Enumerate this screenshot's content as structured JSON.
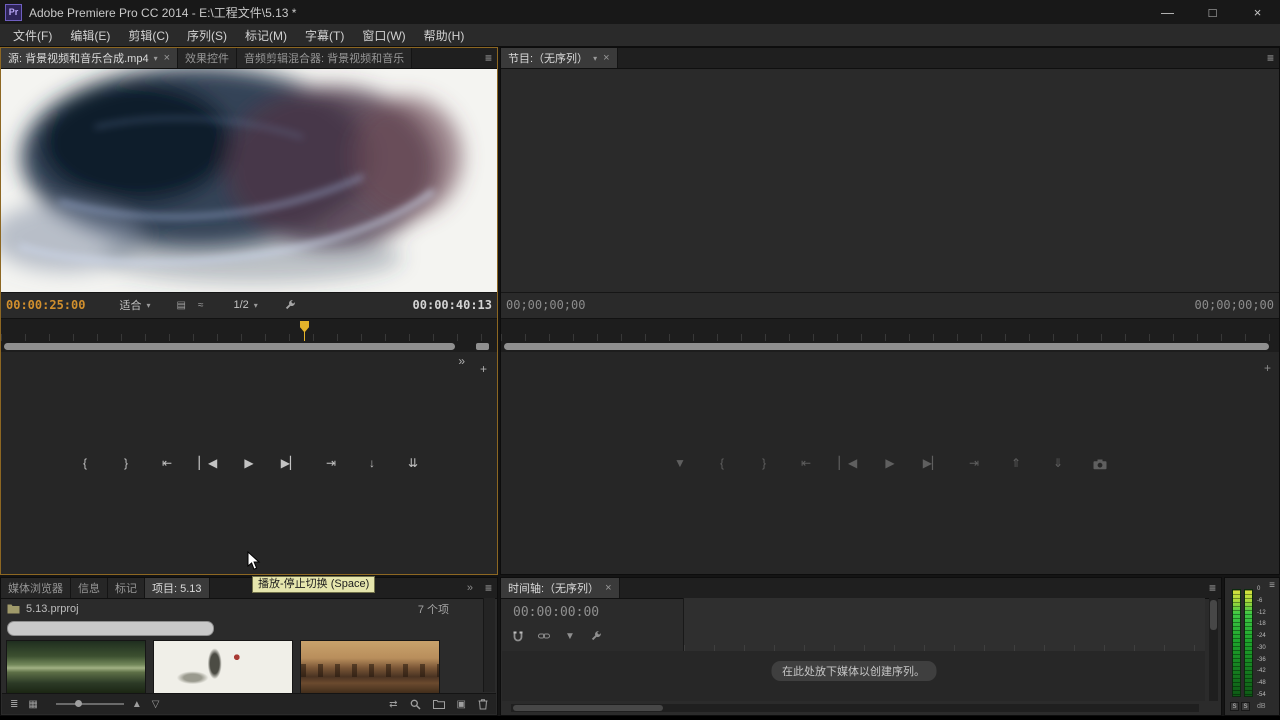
{
  "titlebar": {
    "logo": "Pr",
    "title": "Adobe Premiere Pro CC 2014 - E:\\工程文件\\5.13 *"
  },
  "menubar": [
    "文件(F)",
    "编辑(E)",
    "剪辑(C)",
    "序列(S)",
    "标记(M)",
    "字幕(T)",
    "窗口(W)",
    "帮助(H)"
  ],
  "source_panel": {
    "tabs": [
      "源: 背景视频和音乐合成.mp4",
      "效果控件",
      "音频剪辑混合器: 背景视频和音乐"
    ],
    "timecode_current": "00:00:25:00",
    "fit": "适合",
    "resolution": "1/2",
    "timecode_duration": "00:00:40:13"
  },
  "program_panel": {
    "tab": "节目:（无序列）",
    "timecode_current": "00;00;00;00",
    "timecode_duration": "00;00;00;00"
  },
  "project_panel": {
    "tabs": [
      "媒体浏览器",
      "信息",
      "标记",
      "项目: 5.13"
    ],
    "project_file": "5.13.prproj",
    "item_count": "7 个项"
  },
  "timeline_panel": {
    "tab": "时间轴:（无序列）",
    "timecode": "00:00:00:00",
    "drop_message": "在此处放下媒体以创建序列。"
  },
  "audio_meter": {
    "scale": [
      "0",
      "-6",
      "-12",
      "-18",
      "-24",
      "-30",
      "-36",
      "-42",
      "-48",
      "-54"
    ],
    "solo_left": "S",
    "solo_right": "S",
    "db": "dB"
  },
  "tooltip": "播放-停止切换 (Space)",
  "icons": {
    "minimize": "—",
    "maximize": "□",
    "close": "×",
    "tab_close": "×",
    "panel_menu": "≡",
    "overflow": "»",
    "dropdown": "▾",
    "mark_in": "{",
    "mark_out": "}",
    "go_to_in": "⇤",
    "go_to_out": "⇥",
    "step_back": "▏◀",
    "step_forward": "▶▏",
    "play_stop": "▶",
    "insert": "↓",
    "overwrite": "⇊",
    "add_marker": "▼",
    "lift": "⇑",
    "extract": "⇓",
    "plus": "+",
    "drag_video": "▤",
    "drag_audio": "≈",
    "list_view": "≣",
    "icon_view": "▦",
    "sort_up": "▲",
    "sort_down": "▽",
    "automate": "⇄",
    "new_item": "▣"
  }
}
